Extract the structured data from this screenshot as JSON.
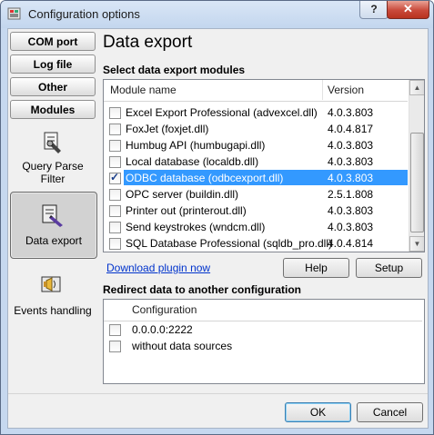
{
  "window": {
    "title": "Configuration options",
    "help_glyph": "?",
    "close_glyph": "✕"
  },
  "sidebar": {
    "tabs": [
      {
        "label": "COM port"
      },
      {
        "label": "Log file"
      },
      {
        "label": "Other"
      },
      {
        "label": "Modules"
      }
    ],
    "items": [
      {
        "label": "Query Parse Filter",
        "icon": "query-parse-filter-icon"
      },
      {
        "label": "Data export",
        "icon": "data-export-icon",
        "selected": true
      },
      {
        "label": "Events handling",
        "icon": "events-handling-icon"
      }
    ]
  },
  "main": {
    "title": "Data export",
    "modules_section": "Select data export modules",
    "columns": {
      "name": "Module name",
      "version": "Version"
    },
    "modules": [
      {
        "name": "Excel Export Professional (advexcel.dll)",
        "version": "4.0.3.803",
        "checked": false
      },
      {
        "name": "FoxJet (foxjet.dll)",
        "version": "4.0.4.817",
        "checked": false
      },
      {
        "name": "Humbug API (humbugapi.dll)",
        "version": "4.0.3.803",
        "checked": false
      },
      {
        "name": "Local database (localdb.dll)",
        "version": "4.0.3.803",
        "checked": false
      },
      {
        "name": "ODBC database (odbcexport.dll)",
        "version": "4.0.3.803",
        "checked": true,
        "selected": true
      },
      {
        "name": "OPC server (buildin.dll)",
        "version": "2.5.1.808",
        "checked": false
      },
      {
        "name": "Printer out (printerout.dll)",
        "version": "4.0.3.803",
        "checked": false
      },
      {
        "name": "Send keystrokes (wndcm.dll)",
        "version": "4.0.3.803",
        "checked": false
      },
      {
        "name": "SQL Database Professional (sqldb_pro.dll)",
        "version": "4.0.4.814",
        "checked": false
      }
    ],
    "download_link": "Download plugin now",
    "help_button": "Help",
    "setup_button": "Setup",
    "redirect_section": "Redirect data to another configuration",
    "redirect_column": "Configuration",
    "redirect_items": [
      {
        "name": "0.0.0.0:2222",
        "checked": false
      },
      {
        "name": "without data sources",
        "checked": false
      }
    ]
  },
  "footer": {
    "ok_button": "OK",
    "cancel_button": "Cancel"
  }
}
